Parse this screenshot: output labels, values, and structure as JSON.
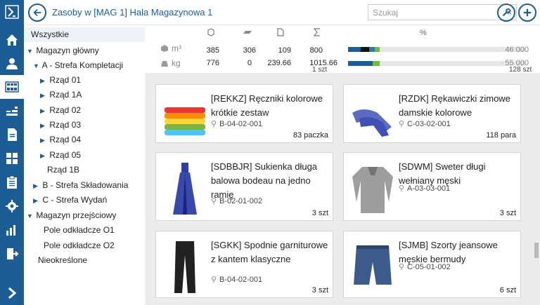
{
  "header": {
    "title": "Zasoby w [MAG 1] Hala Magazynowa 1",
    "search_placeholder": "Szukaj",
    "clear_icon": "close-icon",
    "tools_icon": "wrench-icon",
    "add_icon": "plus-icon"
  },
  "rail": {
    "icons": [
      "logo-icon",
      "home-icon",
      "users-icon",
      "warehouse-grid-icon",
      "barcode-icon",
      "document-icon",
      "tiles-icon",
      "clipboard-icon",
      "gear-icon",
      "bar-chart-icon",
      "exit-icon",
      "chevron-right-icon"
    ],
    "active_index": 3
  },
  "tree": {
    "all_label": "Wszystkie",
    "items": [
      {
        "label": "Magazyn główny",
        "arrow": "▼"
      },
      {
        "label": "A - Strefa Kompletacji",
        "arrow": "▼"
      },
      {
        "label": "Rząd 01",
        "arrow": "▶"
      },
      {
        "label": "Rząd 1A",
        "arrow": "▶"
      },
      {
        "label": "Rząd 02",
        "arrow": "▶"
      },
      {
        "label": "Rząd 03",
        "arrow": "▶"
      },
      {
        "label": "Rząd 04",
        "arrow": "▶"
      },
      {
        "label": "Rząd 05",
        "arrow": "▶"
      },
      {
        "label": "Rząd 1B",
        "arrow": ""
      },
      {
        "label": "B - Strefa Składowania",
        "arrow": "▶"
      },
      {
        "label": "C - Strefa Wydań",
        "arrow": "▶"
      },
      {
        "label": "Magazyn przejściowy",
        "arrow": "▼"
      },
      {
        "label": "Pole odkładcze O1",
        "arrow": ""
      },
      {
        "label": "Pole odkładcze O2",
        "arrow": ""
      },
      {
        "label": "Nieokreślone",
        "arrow": ""
      }
    ]
  },
  "stats": {
    "headers": {
      "pct": "%"
    },
    "header_icons": [
      "box-icon",
      "layer-icon",
      "page-icon",
      "sum-icon"
    ],
    "rows": [
      {
        "unit": "m³",
        "unit_icon": "cube-icon",
        "v1": "385",
        "v2": "306",
        "v3": "109",
        "v4": "800",
        "total": "46 000",
        "fill": [
          0.07,
          0.05,
          0.03,
          0.03
        ]
      },
      {
        "unit": "kg",
        "unit_icon": "weight-icon",
        "v1": "776",
        "v2": "0",
        "v3": "239.66",
        "v4": "1015.66",
        "total": "55 000",
        "fill": [
          0.14,
          0.0,
          0.0,
          0.04
        ]
      }
    ],
    "segment_colors": [
      "#1d5d96",
      "#111111",
      "#2d7da0",
      "#6cbf3a"
    ],
    "partial_left": "1 szt",
    "partial_right": "128 szt"
  },
  "products": [
    {
      "name": "[REKKZ] Ręczniki kolorowe krótkie zestaw",
      "location": "B-04-02-001",
      "qty": "83 paczka",
      "image": "towels-stack"
    },
    {
      "name": "[RZDK] Rękawiczki zimowe damskie kolorowe",
      "location": "C-03-02-001",
      "qty": "118 para",
      "image": "gloves"
    },
    {
      "name": "[SDBBJR] Sukienka długa balowa bodeau na jedno ramię",
      "location": "B-02-01-002",
      "qty": "3 szt",
      "image": "dress"
    },
    {
      "name": "[SDWM] Sweter długi wełniany męski",
      "location": "A-03-03-001",
      "qty": "3 szt",
      "image": "sweater"
    },
    {
      "name": "[SGKK] Spodnie garniturowe z kantem klasyczne",
      "location": "B-04-02-001",
      "qty": "3 szt",
      "image": "trousers"
    },
    {
      "name": "[SJMB] Szorty jeansowe męskie bermudy",
      "location": "C-05-01-002",
      "qty": "6 szt",
      "image": "shorts"
    }
  ]
}
